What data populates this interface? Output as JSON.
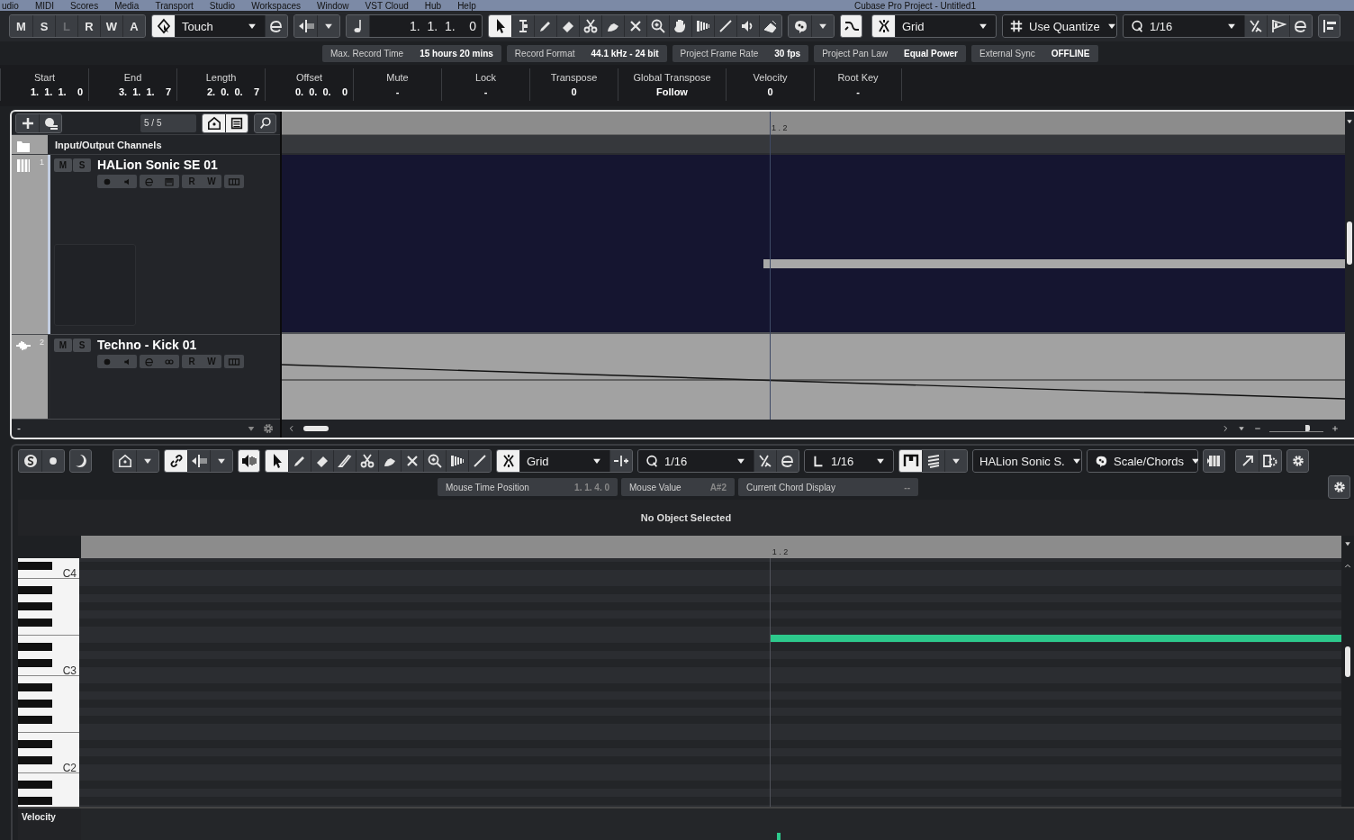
{
  "menu_bar": {
    "items": [
      "udio",
      "MIDI",
      "Scores",
      "Media",
      "Transport",
      "Studio",
      "Workspaces",
      "Window",
      "VST Cloud",
      "Hub",
      "Help"
    ],
    "title": "Cubase Pro Project - Untitled1"
  },
  "toolbar": {
    "automation_buttons": [
      {
        "label": "M",
        "disabled": false
      },
      {
        "label": "S",
        "disabled": false
      },
      {
        "label": "L",
        "disabled": true
      },
      {
        "label": "R",
        "disabled": false
      },
      {
        "label": "W",
        "disabled": false
      },
      {
        "label": "A",
        "disabled": false
      }
    ],
    "automation_mode": "Touch",
    "position": "1.  1.  1.    0",
    "tools": [
      {
        "kind": "object",
        "selected": true
      },
      {
        "kind": "range",
        "selected": false
      },
      {
        "kind": "draw",
        "selected": false
      },
      {
        "kind": "erase",
        "selected": false
      },
      {
        "kind": "split",
        "selected": false
      },
      {
        "kind": "glue",
        "selected": false
      },
      {
        "kind": "mute",
        "selected": false
      },
      {
        "kind": "zoom",
        "selected": false
      },
      {
        "kind": "hand",
        "selected": false
      },
      {
        "kind": "comp",
        "selected": false
      },
      {
        "kind": "line",
        "selected": false
      },
      {
        "kind": "play",
        "selected": false
      },
      {
        "kind": "trim",
        "selected": false
      }
    ],
    "chase_on": true,
    "snap_on": true,
    "snap_type": "Grid",
    "grid_type": "Use Quantize",
    "quantize": "1/16"
  },
  "status_line": [
    {
      "label": "Max. Record Time",
      "value": "15 hours 20 mins"
    },
    {
      "label": "Record Format",
      "value": "44.1 kHz - 24 bit"
    },
    {
      "label": "Project Frame Rate",
      "value": "30 fps"
    },
    {
      "label": "Project Pan Law",
      "value": "Equal Power"
    },
    {
      "label": "External Sync",
      "value": "OFFLINE"
    }
  ],
  "info_line": [
    {
      "label": "Start",
      "value": "1.  1.  1.    0"
    },
    {
      "label": "End",
      "value": "3.  1.  1.    7"
    },
    {
      "label": "Length",
      "value": "2.  0.  0.    7"
    },
    {
      "label": "Offset",
      "value": "0.  0.  0.    0"
    },
    {
      "label": "Mute",
      "value": "-"
    },
    {
      "label": "Lock",
      "value": "-"
    },
    {
      "label": "Transpose",
      "value": "0"
    },
    {
      "label": "Global Transpose",
      "value": "Follow"
    },
    {
      "label": "Velocity",
      "value": "0"
    },
    {
      "label": "Root Key",
      "value": "-"
    }
  ],
  "track_list": {
    "count": "5 / 5",
    "folder": "Input/Output Channels",
    "tracks": [
      {
        "number": "1",
        "kind": "instrument",
        "name": "HALion Sonic SE 01",
        "selected": true,
        "mute_button": "M",
        "solo_button": "S",
        "read_button": "R",
        "write_button": "W"
      },
      {
        "number": "2",
        "kind": "audio",
        "name": "Techno - Kick 01",
        "selected": false,
        "mute_button": "M",
        "solo_button": "S",
        "read_button": "R",
        "write_button": "W"
      }
    ],
    "footer": "-"
  },
  "project_ruler": {
    "marker": "1 . 2"
  },
  "zoom_slider": {
    "level": 0.75
  },
  "editor": {
    "toolbar": {
      "link_on": true,
      "feedback_on": true,
      "snap_on": true,
      "bracket_on": true,
      "tools": [
        {
          "kind": "object",
          "selected": true
        },
        {
          "kind": "draw",
          "selected": false
        },
        {
          "kind": "erase",
          "selected": false
        },
        {
          "kind": "knife",
          "selected": false
        },
        {
          "kind": "split",
          "selected": false
        },
        {
          "kind": "glue",
          "selected": false
        },
        {
          "kind": "mute",
          "selected": false
        },
        {
          "kind": "zoom",
          "selected": false
        },
        {
          "kind": "comp",
          "selected": false
        },
        {
          "kind": "line",
          "selected": false
        }
      ],
      "snap_type": "Grid",
      "quantize": "1/16",
      "length": "1/16",
      "instrument": "HALion Sonic S.",
      "scale": "Scale/Chords"
    },
    "status": [
      {
        "label": "Mouse Time Position",
        "value": "1.  1.  4.    0"
      },
      {
        "label": "Mouse Value",
        "value": "A#2"
      },
      {
        "label": "Current Chord Display",
        "value": "--"
      }
    ],
    "message": "No Object Selected",
    "ruler_marker": "1 . 2",
    "key_labels": [
      "C4",
      "C3",
      "C2"
    ],
    "lane": "Velocity"
  }
}
